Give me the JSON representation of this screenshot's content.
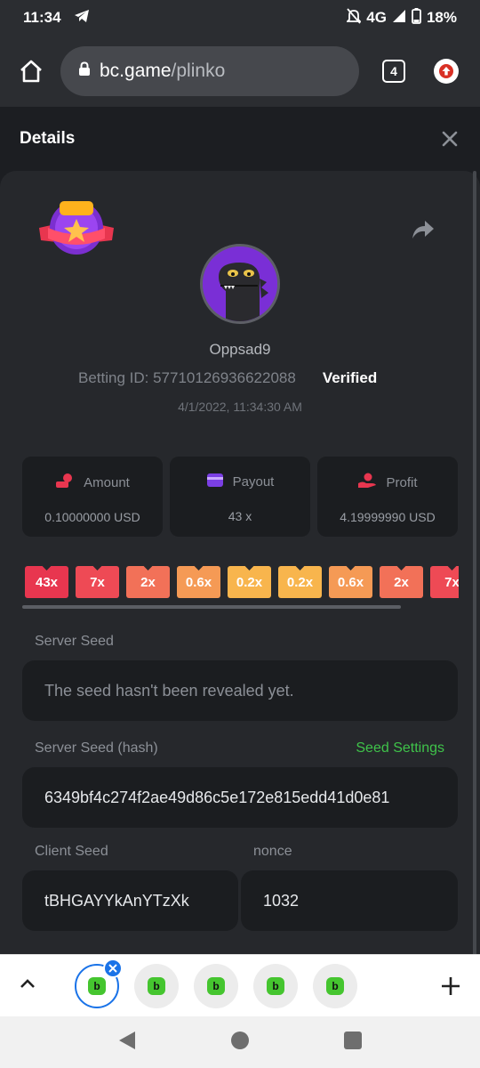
{
  "status": {
    "time": "11:34",
    "network": "4G",
    "battery": "18%"
  },
  "browser": {
    "url_host": "bc.game",
    "url_path": "/plinko",
    "tab_count": "4"
  },
  "sheet": {
    "title": "Details"
  },
  "bet": {
    "username": "Oppsad9",
    "betting_id": "Betting ID: 57710126936622088",
    "verified": "Verified",
    "date": "4/1/2022, 11:34:30 AM"
  },
  "stats": [
    {
      "label": "Amount",
      "value": "0.10000000 USD",
      "icon_color": "#e8364f"
    },
    {
      "label": "Payout",
      "value": "43 x",
      "icon_color": "#7b3fe4"
    },
    {
      "label": "Profit",
      "value": "4.19999990 USD",
      "icon_color": "#e8364f"
    }
  ],
  "multipliers": [
    {
      "label": "43x",
      "color": "#e8364f"
    },
    {
      "label": "7x",
      "color": "#ee4a55"
    },
    {
      "label": "2x",
      "color": "#f27158"
    },
    {
      "label": "0.6x",
      "color": "#f59a55"
    },
    {
      "label": "0.2x",
      "color": "#f8b54d"
    },
    {
      "label": "0.2x",
      "color": "#f8b54d"
    },
    {
      "label": "0.6x",
      "color": "#f59a55"
    },
    {
      "label": "2x",
      "color": "#f27158"
    },
    {
      "label": "7x",
      "color": "#ee4a55"
    }
  ],
  "fields": {
    "server_seed_label": "Server Seed",
    "server_seed_value": "The seed hasn't been revealed yet.",
    "server_seed_hash_label": "Server Seed (hash)",
    "seed_settings": "Seed Settings",
    "server_seed_hash_value": "6349bf4c274f2ae49d86c5e172e815edd41d0e81",
    "client_seed_label": "Client Seed",
    "client_seed_value": "tBHGAYYkAnYTzXk",
    "nonce_label": "nonce",
    "nonce_value": "1032"
  },
  "accent": {
    "green": "#3fc34a",
    "card": "#26282c",
    "box": "#1b1d20"
  }
}
